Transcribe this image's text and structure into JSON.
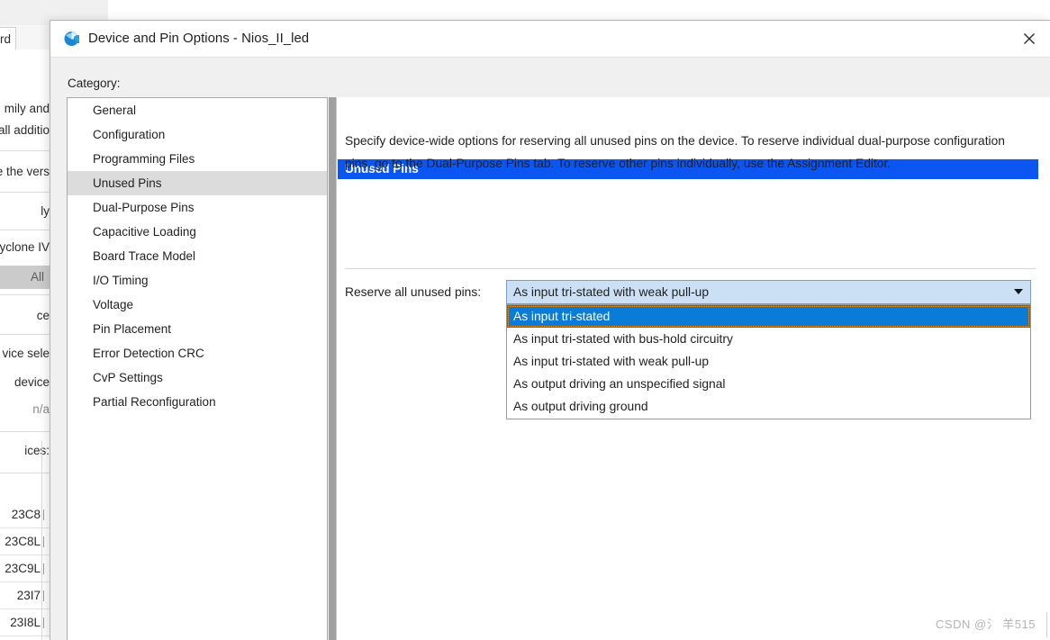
{
  "background": {
    "tab_label": "oard",
    "lines": [
      "mily and",
      "all additio",
      "e the vers",
      "ly",
      "yclone IV"
    ],
    "chip_label": "All",
    "line_after_chip": "ce",
    "lines2": [
      "vice sele",
      "device ",
      "n/a",
      "ices:"
    ],
    "device_rows": [
      "23C8",
      "23C8L",
      "23C9L",
      "23I7",
      "23I8L"
    ]
  },
  "dialog": {
    "title": "Device and Pin Options - Nios_II_led",
    "title_icon": "quartus-sphere-icon",
    "close_icon": "close-icon",
    "category_label": "Category:",
    "categories": [
      {
        "label": "General",
        "selected": false
      },
      {
        "label": "Configuration",
        "selected": false
      },
      {
        "label": "Programming Files",
        "selected": false
      },
      {
        "label": "Unused Pins",
        "selected": true
      },
      {
        "label": "Dual-Purpose Pins",
        "selected": false
      },
      {
        "label": "Capacitive Loading",
        "selected": false
      },
      {
        "label": "Board Trace Model",
        "selected": false
      },
      {
        "label": "I/O Timing",
        "selected": false
      },
      {
        "label": "Voltage",
        "selected": false
      },
      {
        "label": "Pin Placement",
        "selected": false
      },
      {
        "label": "Error Detection CRC",
        "selected": false
      },
      {
        "label": "CvP Settings",
        "selected": false
      },
      {
        "label": "Partial Reconfiguration",
        "selected": false
      }
    ],
    "pane": {
      "header": "Unused Pins",
      "description": "Specify device-wide options for reserving all unused pins on the device. To reserve individual dual-purpose configuration pins, go to the Dual-Purpose Pins tab. To reserve other pins individually, use the Assignment Editor.",
      "field_label": "Reserve all unused pins:",
      "combo_value": "As input tri-stated with weak pull-up",
      "combo_arrow_icon": "chevron-down-icon",
      "dropdown_options": [
        {
          "label": "As input tri-stated",
          "highlighted": true
        },
        {
          "label": "As input tri-stated with bus-hold circuitry",
          "highlighted": false
        },
        {
          "label": "As input tri-stated with weak pull-up",
          "highlighted": false
        },
        {
          "label": "As output driving an unspecified signal",
          "highlighted": false
        },
        {
          "label": "As output driving ground",
          "highlighted": false
        }
      ]
    }
  },
  "watermark": "CSDN @氵 羊515",
  "colors": {
    "header_blue": "#0b56f0",
    "highlight_blue": "#0b7bd8",
    "combo_fill": "#cce0f5",
    "selected_grey": "#dcdcdc"
  }
}
